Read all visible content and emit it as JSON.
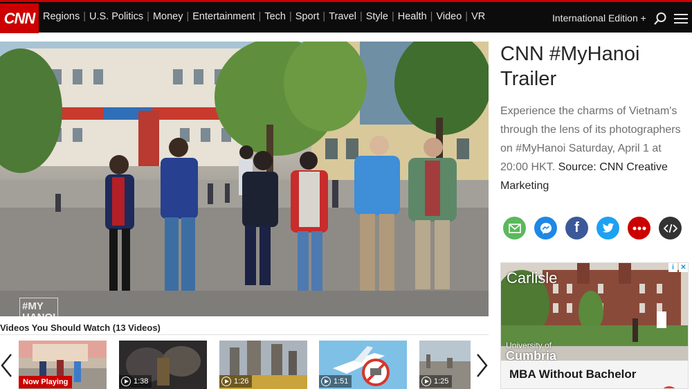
{
  "header": {
    "logo": "CNN",
    "nav": [
      "Regions",
      "U.S. Politics",
      "Money",
      "Entertainment",
      "Tech",
      "Sport",
      "Travel",
      "Style",
      "Health",
      "Video",
      "VR"
    ],
    "edition": "International Edition +"
  },
  "player": {
    "watermark": "#MY HANOI"
  },
  "video": {
    "title": "CNN #MyHanoi Trailer",
    "description": "Experience the charms of Vietnam's through the lens of its photographers on #MyHanoi Saturday, April 1 at 20:00 HKT.",
    "source": "Source: CNN Creative Marketing"
  },
  "share": [
    {
      "icon": "email-icon",
      "color": "#5bb85c",
      "glyph": "✉"
    },
    {
      "icon": "messenger-icon",
      "color": "#1e88e5",
      "glyph": "ϟ"
    },
    {
      "icon": "facebook-icon",
      "color": "#3b5998",
      "glyph": "f"
    },
    {
      "icon": "twitter-icon",
      "color": "#1da1f2",
      "glyph": "t"
    },
    {
      "icon": "more-icon",
      "color": "#cc0000",
      "glyph": "•••"
    },
    {
      "icon": "embed-icon",
      "color": "#333333",
      "glyph": "</>"
    }
  ],
  "ad": {
    "brand": "Carlisle",
    "university_line1": "University of",
    "university_line2": "Cumbria",
    "headline": "MBA Without Bachelor"
  },
  "related": {
    "title": "Videos You Should Watch (13 Videos)",
    "now_playing": "Now Playing",
    "items": [
      {
        "duration": ""
      },
      {
        "duration": "1:38"
      },
      {
        "duration": "1:26"
      },
      {
        "duration": "1:51"
      },
      {
        "duration": "1:25"
      }
    ]
  }
}
